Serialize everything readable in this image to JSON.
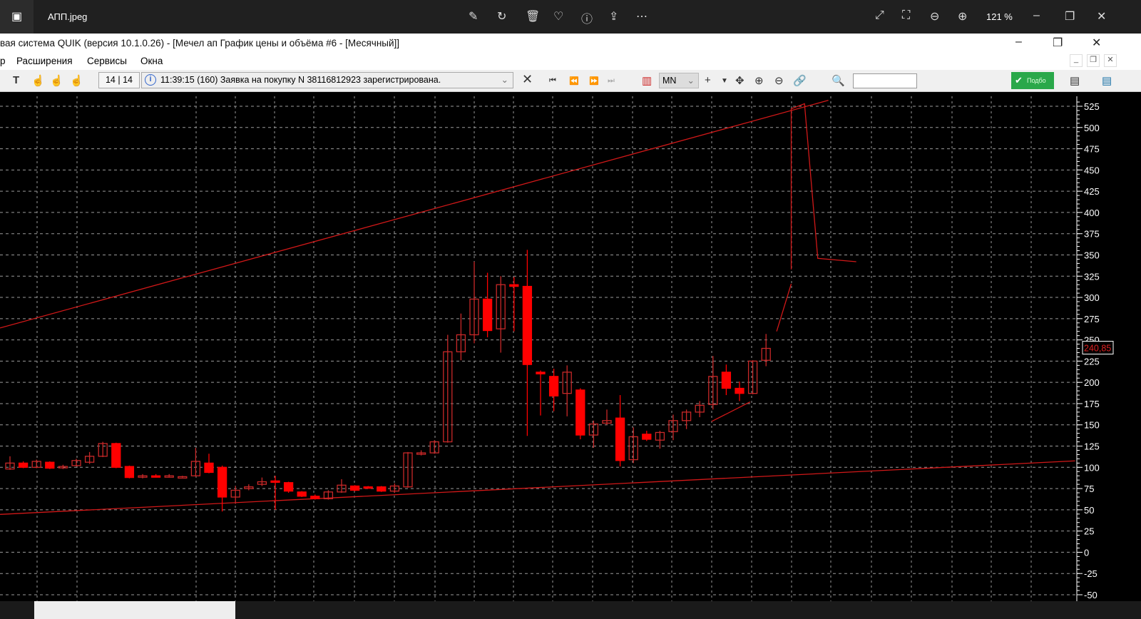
{
  "viewer": {
    "file_name": "АПП.jpeg",
    "zoom": "121 %",
    "icons": [
      "photos-app-icon",
      "edit-icon",
      "rotate-icon",
      "delete-icon",
      "favorite-icon",
      "info-icon",
      "share-icon",
      "more-icon",
      "fullscreen-icon",
      "fit-icon",
      "zoom-out-icon",
      "zoom-in-icon"
    ]
  },
  "window": {
    "title": "вая система QUIK (версия 10.1.0.26) - [Мечел ап График цены и объёма #6 - [Месячный]]"
  },
  "menu": {
    "items": [
      "р",
      "Расширения",
      "Сервисы",
      "Окна"
    ]
  },
  "toolbar": {
    "counter": "14 | 14",
    "message": "11:39:15  (160) Заявка на покупку N 38116812923 зарегистрирована.",
    "interval": "MN",
    "search_value": "",
    "podbor": "Подбо"
  },
  "chart_data": {
    "type": "candlestick",
    "ylim": [
      -50,
      535
    ],
    "yticks": [
      525,
      500,
      475,
      450,
      425,
      400,
      375,
      350,
      325,
      300,
      275,
      250,
      225,
      200,
      175,
      150,
      125,
      100,
      75,
      50,
      25,
      0,
      -25,
      -50
    ],
    "last_price": "240,85",
    "grid": true,
    "colors": {
      "candle": "#ff0000",
      "hollow": "#c82828",
      "line": "#d01818",
      "background": "#000000",
      "grid": "#9a9a9a",
      "axis": "#ffffff"
    },
    "candles_ohlc": [
      [
        98,
        113,
        97,
        105
      ],
      [
        105,
        107,
        99,
        100
      ],
      [
        100,
        109,
        99,
        107
      ],
      [
        106,
        107,
        98,
        99
      ],
      [
        100,
        103,
        98,
        101
      ],
      [
        102,
        110,
        101,
        108
      ],
      [
        106,
        118,
        104,
        113
      ],
      [
        113,
        130,
        112,
        128
      ],
      [
        128,
        129,
        99,
        100
      ],
      [
        101,
        102,
        87,
        88
      ],
      [
        89,
        92,
        87,
        90
      ],
      [
        90,
        92,
        88,
        89
      ],
      [
        89,
        92,
        88,
        90
      ],
      [
        89,
        90,
        88,
        89
      ],
      [
        90,
        123,
        89,
        107
      ],
      [
        105,
        116,
        93,
        94
      ],
      [
        100,
        102,
        48,
        65
      ],
      [
        65,
        78,
        57,
        73
      ],
      [
        75,
        80,
        73,
        77
      ],
      [
        80,
        88,
        78,
        83
      ],
      [
        84,
        90,
        50,
        83
      ],
      [
        82,
        83,
        70,
        72
      ],
      [
        71,
        72,
        65,
        66
      ],
      [
        66,
        68,
        62,
        63
      ],
      [
        63,
        73,
        62,
        71
      ],
      [
        71,
        86,
        70,
        79
      ],
      [
        78,
        79,
        72,
        73
      ],
      [
        77,
        78,
        75,
        76
      ],
      [
        77,
        78,
        71,
        72
      ],
      [
        72,
        81,
        70,
        78
      ],
      [
        77,
        118,
        76,
        117
      ],
      [
        117,
        120,
        114,
        117
      ],
      [
        117,
        132,
        116,
        130
      ],
      [
        130,
        256,
        129,
        236
      ],
      [
        236,
        281,
        226,
        256
      ],
      [
        256,
        342,
        246,
        298
      ],
      [
        298,
        329,
        253,
        261
      ],
      [
        263,
        325,
        235,
        315
      ],
      [
        315,
        324,
        260,
        313
      ],
      [
        313,
        356,
        137,
        221
      ],
      [
        212,
        214,
        161,
        210
      ],
      [
        207,
        216,
        166,
        184
      ],
      [
        187,
        220,
        160,
        212
      ],
      [
        191,
        193,
        133,
        138
      ],
      [
        138,
        155,
        123,
        151
      ],
      [
        152,
        168,
        150,
        155
      ],
      [
        158,
        185,
        101,
        108
      ],
      [
        109,
        147,
        105,
        136
      ],
      [
        139,
        143,
        131,
        133
      ],
      [
        132,
        143,
        122,
        141
      ],
      [
        142,
        162,
        132,
        155
      ],
      [
        155,
        168,
        145,
        165
      ],
      [
        165,
        178,
        159,
        173
      ],
      [
        174,
        231,
        168,
        207
      ],
      [
        212,
        221,
        185,
        193
      ],
      [
        193,
        201,
        178,
        187
      ],
      [
        187,
        226,
        186,
        225
      ],
      [
        226,
        257,
        219,
        240
      ]
    ],
    "drawn_lines": [
      [
        [
          -0.75,
          264
        ],
        [
          61.7,
          532
        ]
      ],
      [
        [
          -0.75,
          44.6
        ],
        [
          80.3,
          107.6
        ]
      ],
      [
        [
          52.9,
          154
        ],
        [
          55.8,
          177
        ]
      ],
      [
        [
          57.8,
          260
        ],
        [
          58.9,
          316
        ]
      ],
      [
        [
          58.9,
          333
        ],
        [
          58.9,
          522
        ],
        [
          59.9,
          528
        ],
        [
          60.9,
          346
        ],
        [
          63.8,
          342
        ]
      ]
    ]
  }
}
